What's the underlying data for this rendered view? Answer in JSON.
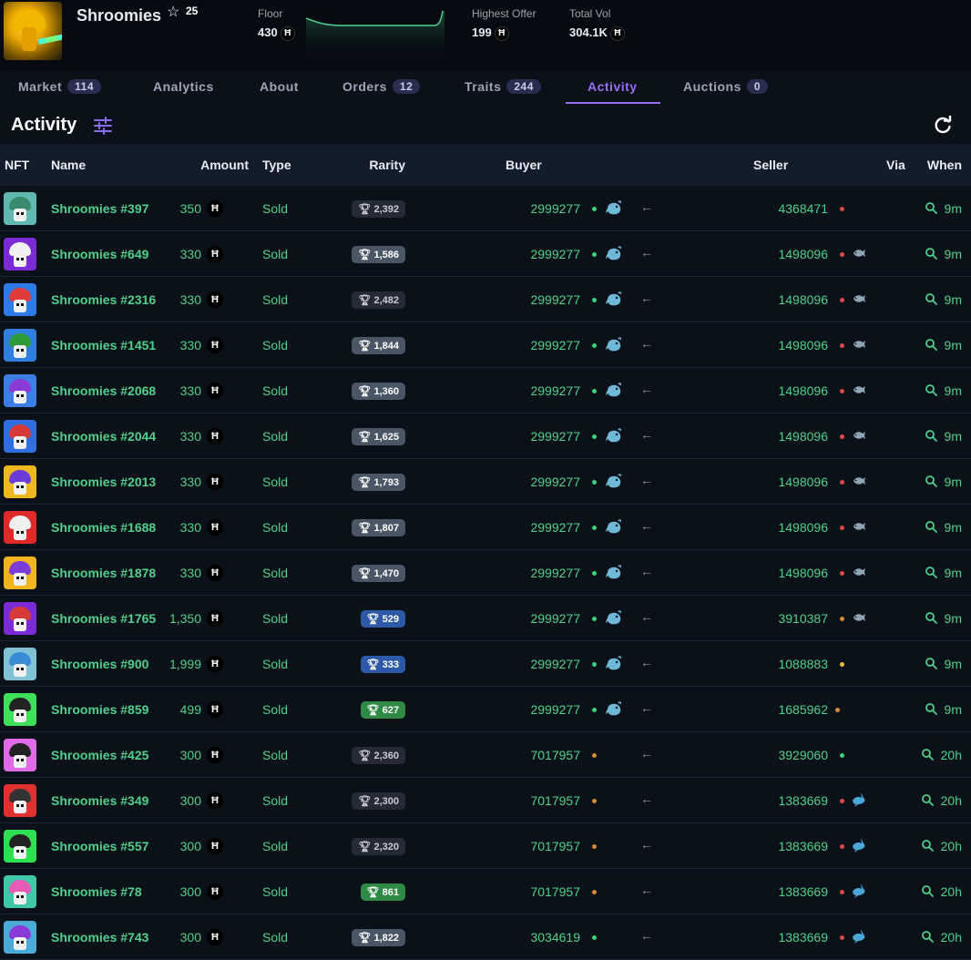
{
  "collection": {
    "name": "Shroomies",
    "star_icon": "star-icon",
    "star_count": "25",
    "floor_label": "Floor",
    "floor_value": "430",
    "highest_offer_label": "Highest Offer",
    "highest_offer_value": "199",
    "total_vol_label": "Total Vol",
    "total_vol_value": "304.1K",
    "currency_symbol": "Ħ"
  },
  "tabs": [
    {
      "label": "Market",
      "badge": "114"
    },
    {
      "label": "Analytics"
    },
    {
      "label": "About"
    },
    {
      "label": "Orders",
      "badge": "12"
    },
    {
      "label": "Traits",
      "badge": "244"
    },
    {
      "label": "Activity",
      "active": true
    },
    {
      "label": "Auctions",
      "badge": "0"
    }
  ],
  "activity": {
    "title": "Activity",
    "filter_icon": "filter-sliders-icon",
    "refresh_icon": "refresh-icon"
  },
  "table": {
    "headers": {
      "nft": "NFT",
      "name": "Name",
      "amount": "Amount",
      "type": "Type",
      "rarity": "Rarity",
      "buyer": "Buyer",
      "seller": "Seller",
      "via": "Via",
      "when": "When"
    },
    "rows": [
      {
        "name": "Shroomies #397",
        "amount": "350",
        "type": "Sold",
        "rarity": "2,392",
        "rarity_style": "r-dark",
        "buyer": "2999277",
        "buyer_dot": "d-green",
        "buyer_badge": "whale",
        "seller": "4368471",
        "seller_dot": "d-red",
        "seller_badge": "",
        "when": "9m",
        "thumb_bg": "#5fb9b0",
        "thumb_cap": "#3a8a6e"
      },
      {
        "name": "Shroomies #649",
        "amount": "330",
        "type": "Sold",
        "rarity": "1,586",
        "rarity_style": "r-grey",
        "buyer": "2999277",
        "buyer_dot": "d-green",
        "buyer_badge": "whale",
        "seller": "1498096",
        "seller_dot": "d-red",
        "seller_badge": "fish",
        "when": "9m",
        "thumb_bg": "#7b2bd6",
        "thumb_cap": "#f0f0f0"
      },
      {
        "name": "Shroomies #2316",
        "amount": "330",
        "type": "Sold",
        "rarity": "2,482",
        "rarity_style": "r-dark",
        "buyer": "2999277",
        "buyer_dot": "d-green",
        "buyer_badge": "whale",
        "seller": "1498096",
        "seller_dot": "d-red",
        "seller_badge": "fish",
        "when": "9m",
        "thumb_bg": "#2b7be8",
        "thumb_cap": "#e23b3b"
      },
      {
        "name": "Shroomies #1451",
        "amount": "330",
        "type": "Sold",
        "rarity": "1,844",
        "rarity_style": "r-grey",
        "buyer": "2999277",
        "buyer_dot": "d-green",
        "buyer_badge": "whale",
        "seller": "1498096",
        "seller_dot": "d-red",
        "seller_badge": "fish",
        "when": "9m",
        "thumb_bg": "#2f7fe0",
        "thumb_cap": "#2f9a3a"
      },
      {
        "name": "Shroomies #2068",
        "amount": "330",
        "type": "Sold",
        "rarity": "1,360",
        "rarity_style": "r-grey",
        "buyer": "2999277",
        "buyer_dot": "d-green",
        "buyer_badge": "whale",
        "seller": "1498096",
        "seller_dot": "d-red",
        "seller_badge": "fish",
        "when": "9m",
        "thumb_bg": "#3a7ee6",
        "thumb_cap": "#8a3bd6"
      },
      {
        "name": "Shroomies #2044",
        "amount": "330",
        "type": "Sold",
        "rarity": "1,625",
        "rarity_style": "r-grey",
        "buyer": "2999277",
        "buyer_dot": "d-green",
        "buyer_badge": "whale",
        "seller": "1498096",
        "seller_dot": "d-red",
        "seller_badge": "fish",
        "when": "9m",
        "thumb_bg": "#2f6fe0",
        "thumb_cap": "#d83a3a"
      },
      {
        "name": "Shroomies #2013",
        "amount": "330",
        "type": "Sold",
        "rarity": "1,793",
        "rarity_style": "r-grey",
        "buyer": "2999277",
        "buyer_dot": "d-green",
        "buyer_badge": "whale",
        "seller": "1498096",
        "seller_dot": "d-red",
        "seller_badge": "fish",
        "when": "9m",
        "thumb_bg": "#f0b81f",
        "thumb_cap": "#6a3bd6"
      },
      {
        "name": "Shroomies #1688",
        "amount": "330",
        "type": "Sold",
        "rarity": "1,807",
        "rarity_style": "r-grey",
        "buyer": "2999277",
        "buyer_dot": "d-green",
        "buyer_badge": "whale",
        "seller": "1498096",
        "seller_dot": "d-red",
        "seller_badge": "fish",
        "when": "9m",
        "thumb_bg": "#e02a2a",
        "thumb_cap": "#f0f0f0"
      },
      {
        "name": "Shroomies #1878",
        "amount": "330",
        "type": "Sold",
        "rarity": "1,470",
        "rarity_style": "r-grey",
        "buyer": "2999277",
        "buyer_dot": "d-green",
        "buyer_badge": "whale",
        "seller": "1498096",
        "seller_dot": "d-red",
        "seller_badge": "fish",
        "when": "9m",
        "thumb_bg": "#f0b41f",
        "thumb_cap": "#7a3bd6"
      },
      {
        "name": "Shroomies #1765",
        "amount": "1,350",
        "type": "Sold",
        "rarity": "529",
        "rarity_style": "r-blue",
        "buyer": "2999277",
        "buyer_dot": "d-green",
        "buyer_badge": "whale",
        "seller": "3910387",
        "seller_dot": "d-orange",
        "seller_badge": "fish",
        "when": "9m",
        "thumb_bg": "#7b2bd6",
        "thumb_cap": "#d83a3a"
      },
      {
        "name": "Shroomies #900",
        "amount": "1,999",
        "type": "Sold",
        "rarity": "333",
        "rarity_style": "r-blue",
        "buyer": "2999277",
        "buyer_dot": "d-green",
        "buyer_badge": "whale",
        "seller": "1088883",
        "seller_dot": "d-yellow",
        "seller_badge": "",
        "when": "9m",
        "thumb_bg": "#7fc2d8",
        "thumb_cap": "#3b8ad6"
      },
      {
        "name": "Shroomies #859",
        "amount": "499",
        "type": "Sold",
        "rarity": "627",
        "rarity_style": "r-green",
        "buyer": "2999277",
        "buyer_dot": "d-green",
        "buyer_badge": "whale",
        "seller": "1685962",
        "seller_dot": "d-orange",
        "seller_badge": "",
        "when": "9m",
        "thumb_bg": "#3ee05a",
        "thumb_cap": "#222222"
      },
      {
        "name": "Shroomies #425",
        "amount": "300",
        "type": "Sold",
        "rarity": "2,360",
        "rarity_style": "r-dark",
        "buyer": "7017957",
        "buyer_dot": "d-orange",
        "buyer_badge": "",
        "seller": "3929060",
        "seller_dot": "d-green",
        "seller_badge": "",
        "when": "20h",
        "thumb_bg": "#e06ae8",
        "thumb_cap": "#222222"
      },
      {
        "name": "Shroomies #349",
        "amount": "300",
        "type": "Sold",
        "rarity": "2,300",
        "rarity_style": "r-dark",
        "buyer": "7017957",
        "buyer_dot": "d-orange",
        "buyer_badge": "",
        "seller": "1383669",
        "seller_dot": "d-red",
        "seller_badge": "shark",
        "when": "20h",
        "thumb_bg": "#e03030",
        "thumb_cap": "#333333"
      },
      {
        "name": "Shroomies #557",
        "amount": "300",
        "type": "Sold",
        "rarity": "2,320",
        "rarity_style": "r-dark",
        "buyer": "7017957",
        "buyer_dot": "d-orange",
        "buyer_badge": "",
        "seller": "1383669",
        "seller_dot": "d-red",
        "seller_badge": "shark",
        "when": "20h",
        "thumb_bg": "#2ee050",
        "thumb_cap": "#222222"
      },
      {
        "name": "Shroomies #78",
        "amount": "300",
        "type": "Sold",
        "rarity": "861",
        "rarity_style": "r-green",
        "buyer": "7017957",
        "buyer_dot": "d-orange",
        "buyer_badge": "",
        "seller": "1383669",
        "seller_dot": "d-red",
        "seller_badge": "shark",
        "when": "20h",
        "thumb_bg": "#3ec8a8",
        "thumb_cap": "#e85ab8"
      },
      {
        "name": "Shroomies #743",
        "amount": "300",
        "type": "Sold",
        "rarity": "1,822",
        "rarity_style": "r-grey",
        "buyer": "3034619",
        "buyer_dot": "d-green",
        "buyer_badge": "",
        "seller": "1383669",
        "seller_dot": "d-red",
        "seller_badge": "shark",
        "when": "20h",
        "thumb_bg": "#4aaad8",
        "thumb_cap": "#8a3bd6"
      }
    ]
  },
  "colors": {
    "accent": "#9b6cf5",
    "positive": "#4fd08c",
    "background": "#0b1119",
    "header_row": "#131c2b"
  }
}
